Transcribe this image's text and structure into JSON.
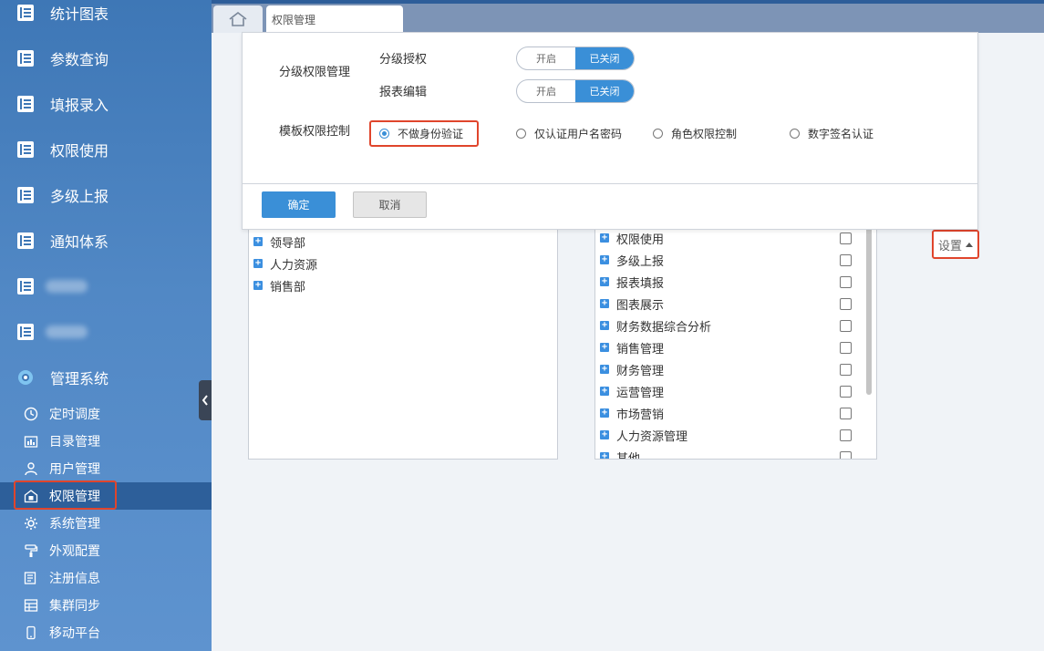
{
  "sidebar": {
    "items": [
      {
        "label": "统计图表",
        "icon": "report-icon"
      },
      {
        "label": "参数查询",
        "icon": "report-icon"
      },
      {
        "label": "填报录入",
        "icon": "report-icon"
      },
      {
        "label": "权限使用",
        "icon": "report-icon"
      },
      {
        "label": "多级上报",
        "icon": "report-icon"
      },
      {
        "label": "通知体系",
        "icon": "report-icon"
      },
      {
        "label": "",
        "icon": "report-icon"
      },
      {
        "label": "",
        "icon": "report-icon"
      }
    ],
    "section": {
      "label": "管理系统",
      "icon": "gear-flower-icon"
    },
    "sub_items": [
      {
        "label": "定时调度",
        "icon": "clock-icon"
      },
      {
        "label": "目录管理",
        "icon": "folder-chart-icon"
      },
      {
        "label": "用户管理",
        "icon": "user-icon"
      },
      {
        "label": "权限管理",
        "icon": "lock-house-icon",
        "active": true
      },
      {
        "label": "系统管理",
        "icon": "gear-icon"
      },
      {
        "label": "外观配置",
        "icon": "paint-roller-icon"
      },
      {
        "label": "注册信息",
        "icon": "register-icon"
      },
      {
        "label": "集群同步",
        "icon": "cluster-icon"
      },
      {
        "label": "移动平台",
        "icon": "mobile-icon"
      }
    ]
  },
  "tabs": {
    "home_icon": "home-icon",
    "active_tab": "权限管理"
  },
  "dialog": {
    "group_label": "分级权限管理",
    "toggles": [
      {
        "label": "分级授权",
        "on_label": "开启",
        "off_label": "已关闭",
        "state": "off"
      },
      {
        "label": "报表编辑",
        "on_label": "开启",
        "off_label": "已关闭",
        "state": "off"
      }
    ],
    "template_label": "模板权限控制",
    "radio_options": [
      {
        "label": "不做身份验证",
        "checked": true
      },
      {
        "label": "仅认证用户名密码",
        "checked": false
      },
      {
        "label": "角色权限控制",
        "checked": false
      },
      {
        "label": "数字签名认证",
        "checked": false
      }
    ],
    "confirm_label": "确定",
    "cancel_label": "取消"
  },
  "left_tree": [
    "领导部",
    "人力资源",
    "销售部"
  ],
  "right_tree": [
    "权限使用",
    "多级上报",
    "报表填报",
    "图表展示",
    "财务数据综合分析",
    "销售管理",
    "财务管理",
    "运营管理",
    "市场营销",
    "人力资源管理",
    "其他"
  ],
  "settings_button": "设置",
  "colors": {
    "accent": "#3a8fd7",
    "highlight": "#e0452c",
    "sidebar": "#4a82c0"
  }
}
